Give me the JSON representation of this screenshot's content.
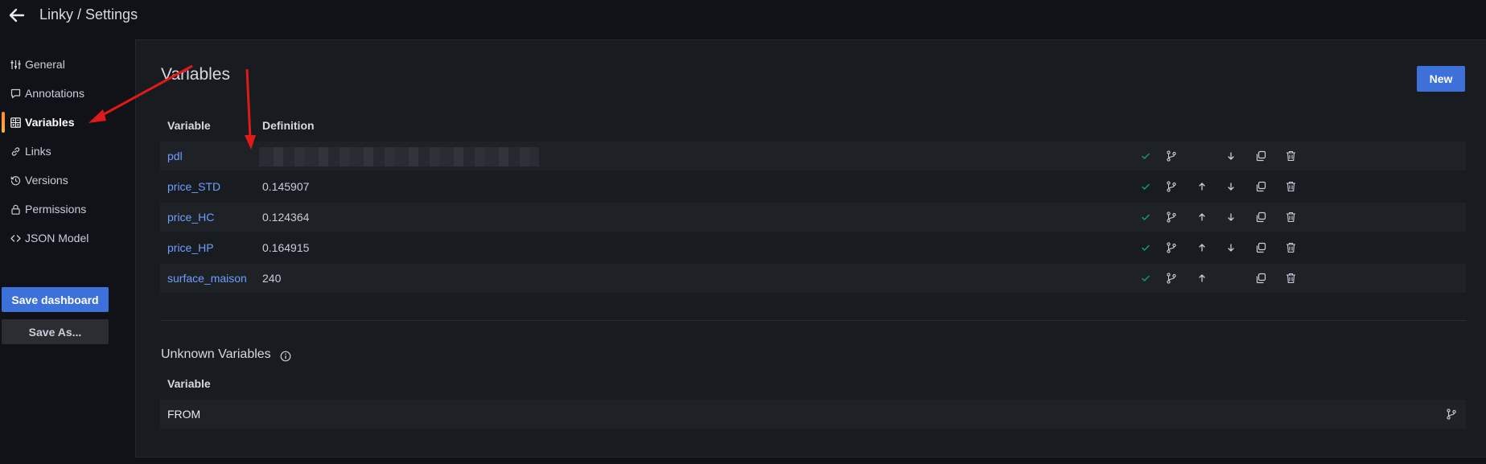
{
  "header": {
    "title": "Linky / Settings"
  },
  "sidebar": {
    "items": [
      {
        "label": "General",
        "icon": "sliders-icon",
        "active": false
      },
      {
        "label": "Annotations",
        "icon": "comment-icon",
        "active": false
      },
      {
        "label": "Variables",
        "icon": "calculator-icon",
        "active": true
      },
      {
        "label": "Links",
        "icon": "link-icon",
        "active": false
      },
      {
        "label": "Versions",
        "icon": "history-icon",
        "active": false
      },
      {
        "label": "Permissions",
        "icon": "lock-icon",
        "active": false
      },
      {
        "label": "JSON Model",
        "icon": "code-icon",
        "active": false
      }
    ],
    "save_label": "Save dashboard",
    "save_as_label": "Save As..."
  },
  "variables": {
    "title": "Variables",
    "new_label": "New",
    "columns": {
      "variable": "Variable",
      "definition": "Definition"
    },
    "rows": [
      {
        "name": "pdl",
        "definition": "",
        "definition_redacted": true,
        "up": false,
        "down": true
      },
      {
        "name": "price_STD",
        "definition": "0.145907",
        "up": true,
        "down": true
      },
      {
        "name": "price_HC",
        "definition": "0.124364",
        "up": true,
        "down": true
      },
      {
        "name": "price_HP",
        "definition": "0.164915",
        "up": true,
        "down": true
      },
      {
        "name": "surface_maison",
        "definition": "240",
        "up": true,
        "down": false
      }
    ]
  },
  "unknown": {
    "title": "Unknown Variables",
    "column": "Variable",
    "rows": [
      {
        "name": "FROM"
      }
    ]
  },
  "colors": {
    "background": "#111217",
    "panel": "#181b1f",
    "link": "#6e9fff",
    "primary": "#3d71d9",
    "success": "#1a9c5a",
    "annotation_arrow": "#ff1a1a"
  }
}
